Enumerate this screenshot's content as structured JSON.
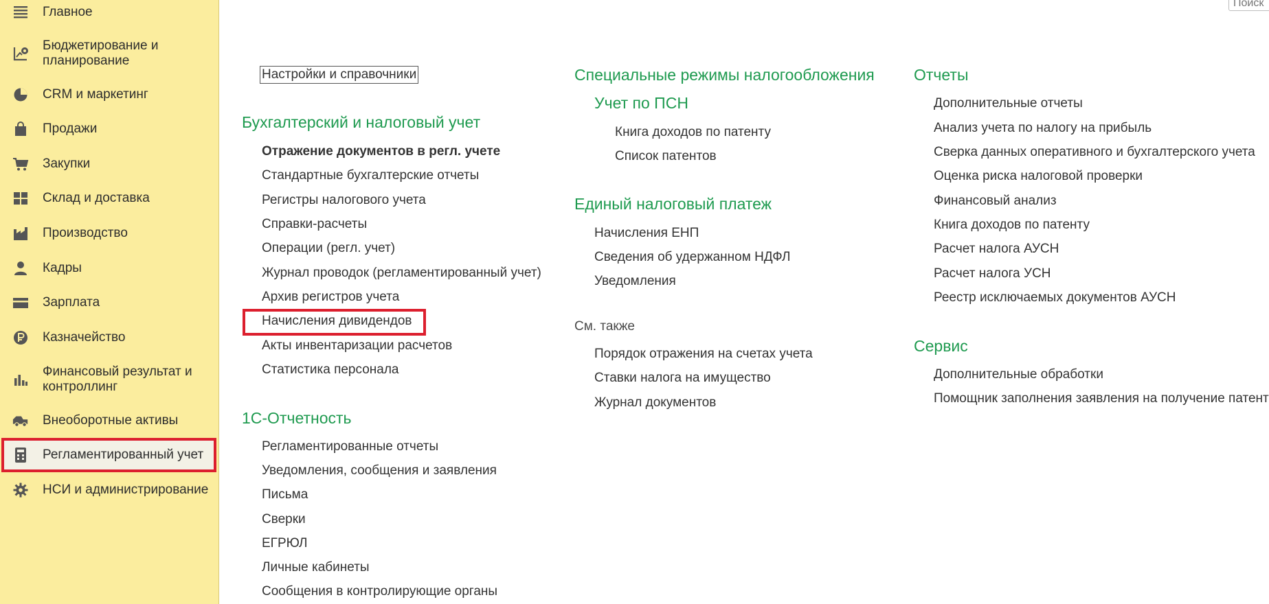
{
  "search": {
    "placeholder": "Поиск"
  },
  "sidebar": {
    "items": [
      {
        "label": "Главное",
        "icon": "menu-lines-icon"
      },
      {
        "label": "Бюджетирование и\nпланирование",
        "icon": "budget-chart-icon"
      },
      {
        "label": "CRM и маркетинг",
        "icon": "pie-chart-icon"
      },
      {
        "label": "Продажи",
        "icon": "shopping-bag-icon"
      },
      {
        "label": "Закупки",
        "icon": "cart-icon"
      },
      {
        "label": "Склад и доставка",
        "icon": "warehouse-grid-icon"
      },
      {
        "label": "Производство",
        "icon": "factory-icon"
      },
      {
        "label": "Кадры",
        "icon": "person-icon"
      },
      {
        "label": "Зарплата",
        "icon": "wallet-card-icon"
      },
      {
        "label": "Казначейство",
        "icon": "ruble-coin-icon"
      },
      {
        "label": "Финансовый результат и\nконтроллинг",
        "icon": "bar-chart-icon"
      },
      {
        "label": "Внеоборотные активы",
        "icon": "truck-icon"
      },
      {
        "label": "Регламентированный учет",
        "icon": "calculator-icon"
      },
      {
        "label": "НСИ и администрирование",
        "icon": "gear-icon"
      }
    ],
    "selected_index": 12
  },
  "col1": {
    "settings_label": "Настройки и справочники",
    "accounting": {
      "title": "Бухгалтерский и налоговый учет",
      "links": [
        "Отражение документов в регл. учете",
        "Стандартные бухгалтерские отчеты",
        "Регистры налогового учета",
        "Справки-расчеты",
        "Операции (регл. учет)",
        "Журнал проводок (регламентированный учет)",
        "Архив регистров учета",
        "Начисления дивидендов",
        "Акты инвентаризации расчетов",
        "Статистика персонала"
      ]
    },
    "reporting": {
      "title": "1С-Отчетность",
      "links": [
        "Регламентированные отчеты",
        "Уведомления, сообщения и заявления",
        "Письма",
        "Сверки",
        "ЕГРЮЛ",
        "Личные кабинеты",
        "Сообщения в контролирующие органы"
      ]
    }
  },
  "col2": {
    "special": {
      "title": "Специальные режимы налогообложения",
      "sub_title": "Учет по ПСН",
      "links": [
        "Книга доходов по патенту",
        "Список патентов"
      ]
    },
    "enp": {
      "title": "Единый налоговый платеж",
      "links": [
        "Начисления ЕНП",
        "Сведения об удержанном НДФЛ",
        "Уведомления"
      ]
    },
    "see_also": {
      "title": "См. также",
      "links": [
        "Порядок отражения на счетах учета",
        "Ставки налога на имущество",
        "Журнал документов"
      ]
    }
  },
  "col3": {
    "reports": {
      "title": "Отчеты",
      "links": [
        "Дополнительные отчеты",
        "Анализ учета по налогу на прибыль",
        "Сверка данных оперативного и бухгалтерского учета",
        "Оценка риска налоговой проверки",
        "Финансовый анализ",
        "Книга доходов по патенту",
        "Расчет налога АУСН",
        "Расчет налога УСН",
        "Реестр исключаемых документов АУСН"
      ]
    },
    "service": {
      "title": "Сервис",
      "links": [
        "Дополнительные обработки",
        "Помощник заполнения заявления на получение патента"
      ]
    }
  },
  "colors": {
    "sidebar_bg": "#fbed9e",
    "section_title": "#1e9a4f",
    "highlight": "#dc1f2e"
  }
}
